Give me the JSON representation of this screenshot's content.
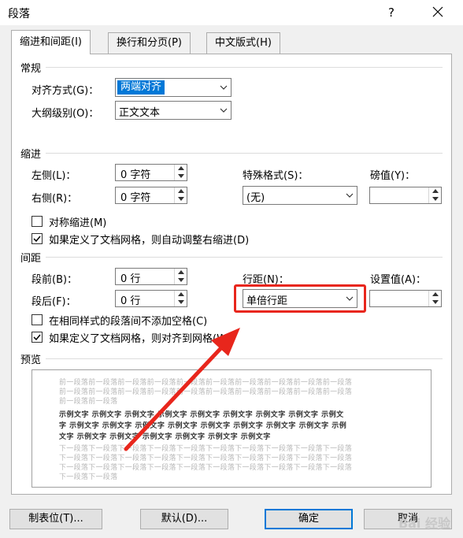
{
  "window": {
    "title": "段落",
    "help": "?"
  },
  "tabs": [
    {
      "label": "缩进和间距(I)"
    },
    {
      "label": "换行和分页(P)"
    },
    {
      "label": "中文版式(H)"
    }
  ],
  "general": {
    "title": "常规",
    "alignment_label": "对齐方式(G)：",
    "alignment_value": "两端对齐",
    "outline_label": "大纲级别(O)：",
    "outline_value": "正文文本"
  },
  "indent": {
    "title": "缩进",
    "left_label": "左侧(L)：",
    "left_value": "0 字符",
    "right_label": "右侧(R)：",
    "right_value": "0 字符",
    "special_label": "特殊格式(S)：",
    "special_value": "(无)",
    "by_label": "磅值(Y)：",
    "by_value": "",
    "mirror_label": "对称缩进(M)",
    "mirror_checked": false,
    "auto_adjust_label": "如果定义了文档网格，则自动调整右缩进(D)",
    "auto_adjust_checked": true
  },
  "spacing": {
    "title": "间距",
    "before_label": "段前(B)：",
    "before_value": "0 行",
    "after_label": "段后(F)：",
    "after_value": "0 行",
    "line_spacing_label": "行距(N)：",
    "line_spacing_value": "单倍行距",
    "at_label": "设置值(A)：",
    "at_value": "",
    "no_space_label": "在相同样式的段落间不添加空格(C)",
    "no_space_checked": false,
    "snap_grid_label": "如果定义了文档网格，则对齐到网格(W)",
    "snap_grid_checked": true
  },
  "preview": {
    "title": "预览",
    "prev_lines": [
      "前一段落前一段落前一段落前一段落前一段落前一段落前一段落前一段落前一段落前一段落",
      "前一段落前一段落前一段落前一段落前一段落前一段落前一段落前一段落前一段落前一段落",
      "前一段落前一段落"
    ],
    "sample_lines": [
      "示例文字 示例文字 示例文字 示例文字 示例文字 示例文字 示例文字 示例文字 示例文",
      "字 示例文字 示例文字 示例文字 示例文字 示例文字 示例文字 示例文字 示例文字 示例",
      "文字 示例文字 示例文字 示例文字 示例文字 示例文字 示例文字"
    ],
    "next_lines": [
      "下一段落下一段落下一段落下一段落下一段落下一段落下一段落下一段落下一段落下一段落",
      "下一段落下一段落下一段落下一段落下一段落下一段落下一段落下一段落下一段落下一段落",
      "下一段落下一段落下一段落下一段落下一段落下一段落下一段落下一段落下一段落下一段落",
      "下一段落下一段落"
    ]
  },
  "buttons": {
    "tabs": "制表位(T)...",
    "default": "默认(D)...",
    "ok": "确定",
    "cancel": "取消"
  },
  "watermark": "Bai 经验",
  "colors": {
    "accent": "#0078d7",
    "annotation": "#e8261c"
  }
}
